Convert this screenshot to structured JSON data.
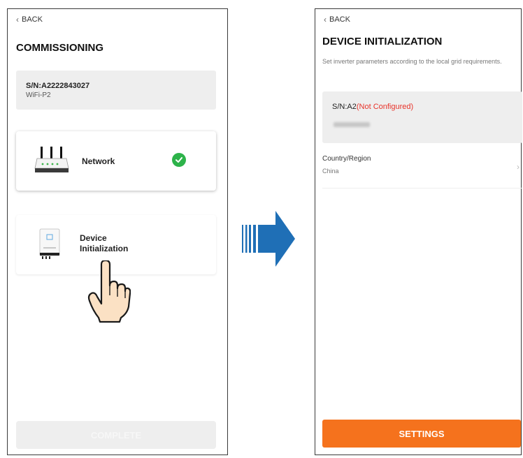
{
  "left": {
    "back_label": "BACK",
    "title": "COMMISSIONING",
    "sn": "S/N:A2222843027",
    "wifi": "WiFi-P2",
    "network_label": "Network",
    "device_label_line1": "Device",
    "device_label_line2": "Initialization",
    "complete_label": "COMPLETE"
  },
  "right": {
    "back_label": "BACK",
    "title": "DEVICE INITIALIZATION",
    "description": "Set inverter parameters according to the local grid requirements.",
    "sn_prefix": "S/N:A2",
    "sn_status": "(Not Configured)",
    "country_label": "Country/Region",
    "country_value": "China",
    "settings_label": "SETTINGS"
  },
  "colors": {
    "accent": "#f5721d",
    "success": "#2db34a",
    "error": "#e8332a",
    "arrow": "#1f6fb6"
  },
  "icons": [
    "chevron-left-icon",
    "router-icon",
    "check-circle-icon",
    "inverter-icon",
    "hand-pointer-icon",
    "arrow-right-icon",
    "chevron-right-icon"
  ]
}
